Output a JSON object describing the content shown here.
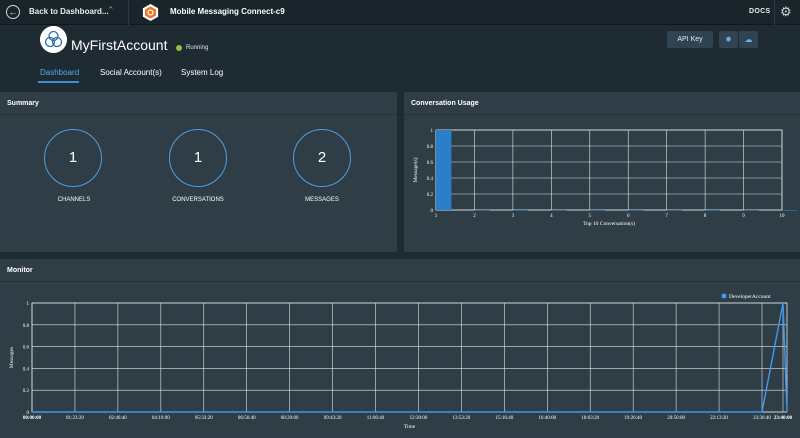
{
  "topbar": {
    "back_label": "Back to Dashboard...",
    "service_title": "Mobile Messaging Connect-c9",
    "docs_label": "DOCS"
  },
  "header": {
    "account_name": "MyFirstAccount",
    "status": "Running",
    "api_key_label": "API Key",
    "tabs": [
      {
        "label": "Dashboard",
        "active": true
      },
      {
        "label": "Social Account(s)",
        "active": false
      },
      {
        "label": "System Log",
        "active": false
      }
    ]
  },
  "summary": {
    "title": "Summary",
    "stats": [
      {
        "value": "1",
        "label": "CHANNELS"
      },
      {
        "value": "1",
        "label": "CONVERSATIONS"
      },
      {
        "value": "2",
        "label": "MESSAGES"
      }
    ]
  },
  "conversation_usage": {
    "title": "Conversation Usage"
  },
  "monitor": {
    "title": "Monitor"
  },
  "colors": {
    "accent": "#3a8fd8",
    "running": "#8cc63f",
    "panel": "#2f3d47"
  },
  "chart_data": [
    {
      "type": "bar",
      "xlabel": "Top 10 Conversation(s)",
      "ylabel": "Message(s)",
      "categories": [
        "1",
        "2",
        "3",
        "4",
        "5",
        "6",
        "7",
        "8",
        "9",
        "10"
      ],
      "values": [
        1,
        0,
        0,
        0,
        0,
        0,
        0,
        0,
        0,
        0
      ],
      "ylim": [
        0,
        1
      ],
      "yticks": [
        "0",
        "0.2",
        "0.4",
        "0.6",
        "0.8",
        "1"
      ],
      "grid": true
    },
    {
      "type": "line",
      "xlabel": "Time",
      "ylabel": "Messages",
      "legend": "top-right",
      "series": [
        {
          "name": "DeveloperAccount",
          "values": [
            0,
            0,
            0,
            0,
            0,
            0,
            0,
            0,
            0,
            0,
            0,
            0,
            0,
            0,
            0,
            0,
            0,
            0,
            1
          ]
        }
      ],
      "x": [
        "00:00:00",
        "01:23:20",
        "02:46:40",
        "04:10:00",
        "05:33:20",
        "06:56:40",
        "08:20:00",
        "09:43:20",
        "11:06:40",
        "12:30:00",
        "13:53:20",
        "15:16:40",
        "16:40:00",
        "18:03:20",
        "19:26:40",
        "20:50:00",
        "22:13:20",
        "23:36:40",
        "23:40:00"
      ],
      "ylim": [
        0,
        1
      ],
      "yticks": [
        "0",
        "0.2",
        "0.4",
        "0.6",
        "0.8",
        "1"
      ],
      "grid": true
    }
  ]
}
